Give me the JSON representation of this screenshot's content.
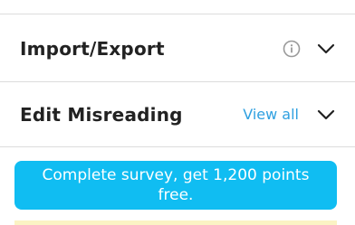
{
  "sections": [
    {
      "title": "Import/Export",
      "has_info_icon": true,
      "icons": [
        "info-icon",
        "chevron-down-icon"
      ]
    },
    {
      "title": "Edit Misreading",
      "action_label": "View all",
      "icons": [
        "chevron-down-icon"
      ]
    }
  ],
  "banner": {
    "text": "Complete survey, get 1,200 points free."
  },
  "colors": {
    "accent": "#10bdf2",
    "link": "#2fa0e0",
    "title_text": "#222222",
    "divider": "#dcdcdc",
    "strip": "#fbf3c4"
  }
}
